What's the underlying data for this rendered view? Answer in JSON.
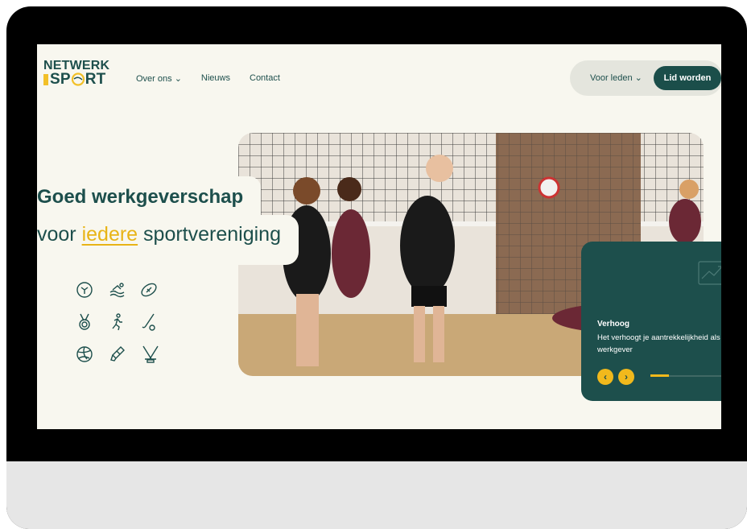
{
  "logo": {
    "line1": "NETWERK",
    "line2": "SP",
    "line2b": "RT"
  },
  "nav": {
    "items": [
      "Over ons",
      "Nieuws",
      "Contact"
    ],
    "over_ons_chevron": "chevron-down-icon"
  },
  "header": {
    "voor_leden": "Voor leden",
    "lid_worden": "Lid worden"
  },
  "hero": {
    "line1": "Goed werkgeverschap",
    "line2_pre": "voor ",
    "line2_hl": "iedere",
    "line2_post": " sportvereniging"
  },
  "sport_icons": [
    "football-icon",
    "swimming-icon",
    "rugby-ball-icon",
    "medal-icon",
    "running-icon",
    "hockey-stick-icon",
    "volleyball-icon",
    "shuttlecock-icon",
    "ice-hockey-icon"
  ],
  "card": {
    "title": "Verhoog",
    "desc": "Het verhoogt je aantrekkelijkheid als werkgever",
    "progress": 0.25
  },
  "colors": {
    "primary": "#1d4f4c",
    "accent": "#f1b91c",
    "background": "#f8f7ef"
  }
}
